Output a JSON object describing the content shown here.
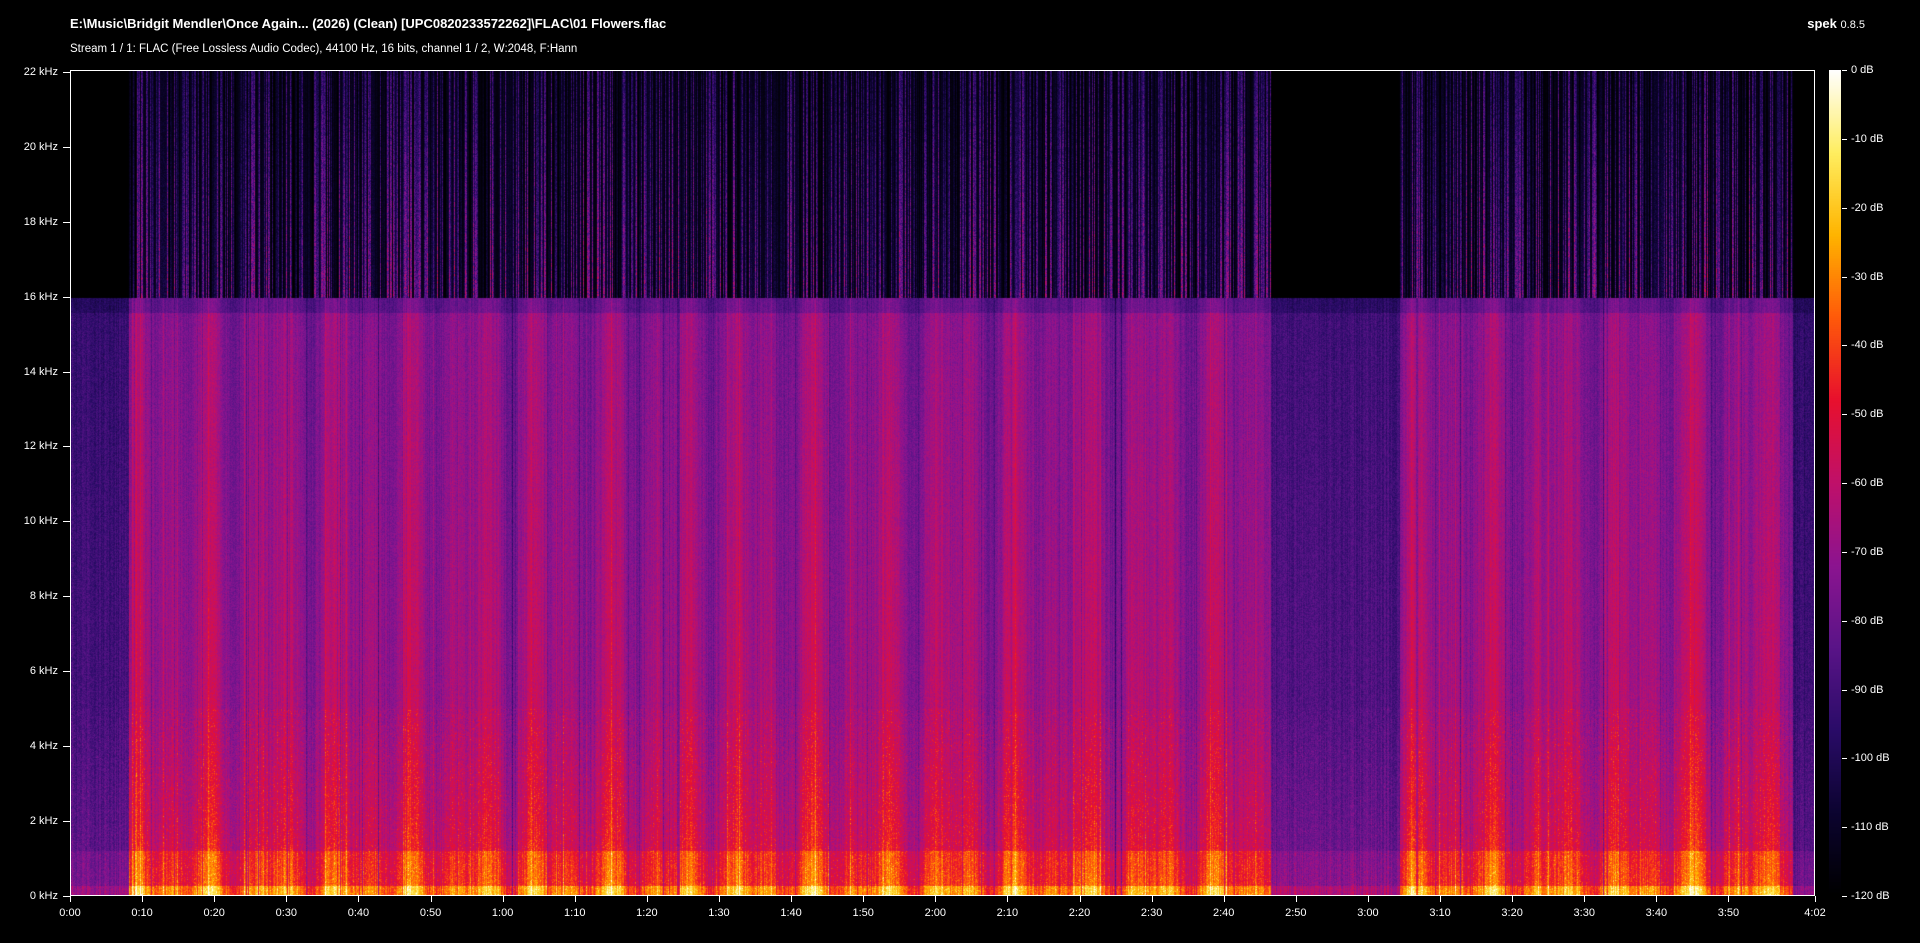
{
  "header": {
    "file_path": "E:\\Music\\Bridgit Mendler\\Once Again... (2026) (Clean) [UPC0820233572262]\\FLAC\\01 Flowers.flac",
    "stream_info": "Stream 1 / 1: FLAC (Free Lossless Audio Codec), 44100 Hz, 16 bits, channel 1 / 2, W:2048, F:Hann",
    "app_name": "spek",
    "app_version": "0.8.5"
  },
  "chart_data": {
    "type": "heatmap",
    "title": "",
    "y_tick_labels": [
      "22 kHz",
      "20 kHz",
      "18 kHz",
      "16 kHz",
      "14 kHz",
      "12 kHz",
      "10 kHz",
      "8 kHz",
      "6 kHz",
      "4 kHz",
      "2 kHz",
      "0 kHz"
    ],
    "y_tick_values_khz": [
      22,
      20,
      18,
      16,
      14,
      12,
      10,
      8,
      6,
      4,
      2,
      0
    ],
    "ylim_khz": [
      0,
      22.05
    ],
    "x_tick_labels": [
      "0:00",
      "0:10",
      "0:20",
      "0:30",
      "0:40",
      "0:50",
      "1:00",
      "1:10",
      "1:20",
      "1:30",
      "1:40",
      "1:50",
      "2:00",
      "2:10",
      "2:20",
      "2:30",
      "2:40",
      "2:50",
      "3:00",
      "3:10",
      "3:20",
      "3:30",
      "3:40",
      "3:50",
      "4:02"
    ],
    "x_tick_values_s": [
      0,
      10,
      20,
      30,
      40,
      50,
      60,
      70,
      80,
      90,
      100,
      110,
      120,
      130,
      140,
      150,
      160,
      170,
      180,
      190,
      200,
      210,
      220,
      230,
      242
    ],
    "duration_s": 242,
    "colorbar_labels": [
      "0 dB",
      "-10 dB",
      "-20 dB",
      "-30 dB",
      "-40 dB",
      "-50 dB",
      "-60 dB",
      "-70 dB",
      "-80 dB",
      "-90 dB",
      "-100 dB",
      "-110 dB",
      "-120 dB"
    ],
    "colorbar_values_db": [
      0,
      -10,
      -20,
      -30,
      -40,
      -50,
      -60,
      -70,
      -80,
      -90,
      -100,
      -110,
      -120
    ],
    "db_range": [
      -120,
      0
    ],
    "lowpass_cutoff_khz": 16,
    "quiet_segment_s": [
      166.5,
      184.5
    ],
    "colormap": [
      "#000000",
      "#0c0430",
      "#2a0c68",
      "#5a1488",
      "#8c1490",
      "#c0106a",
      "#e8102e",
      "#ff5a0a",
      "#ffb400",
      "#ffee60",
      "#ffffff"
    ]
  }
}
